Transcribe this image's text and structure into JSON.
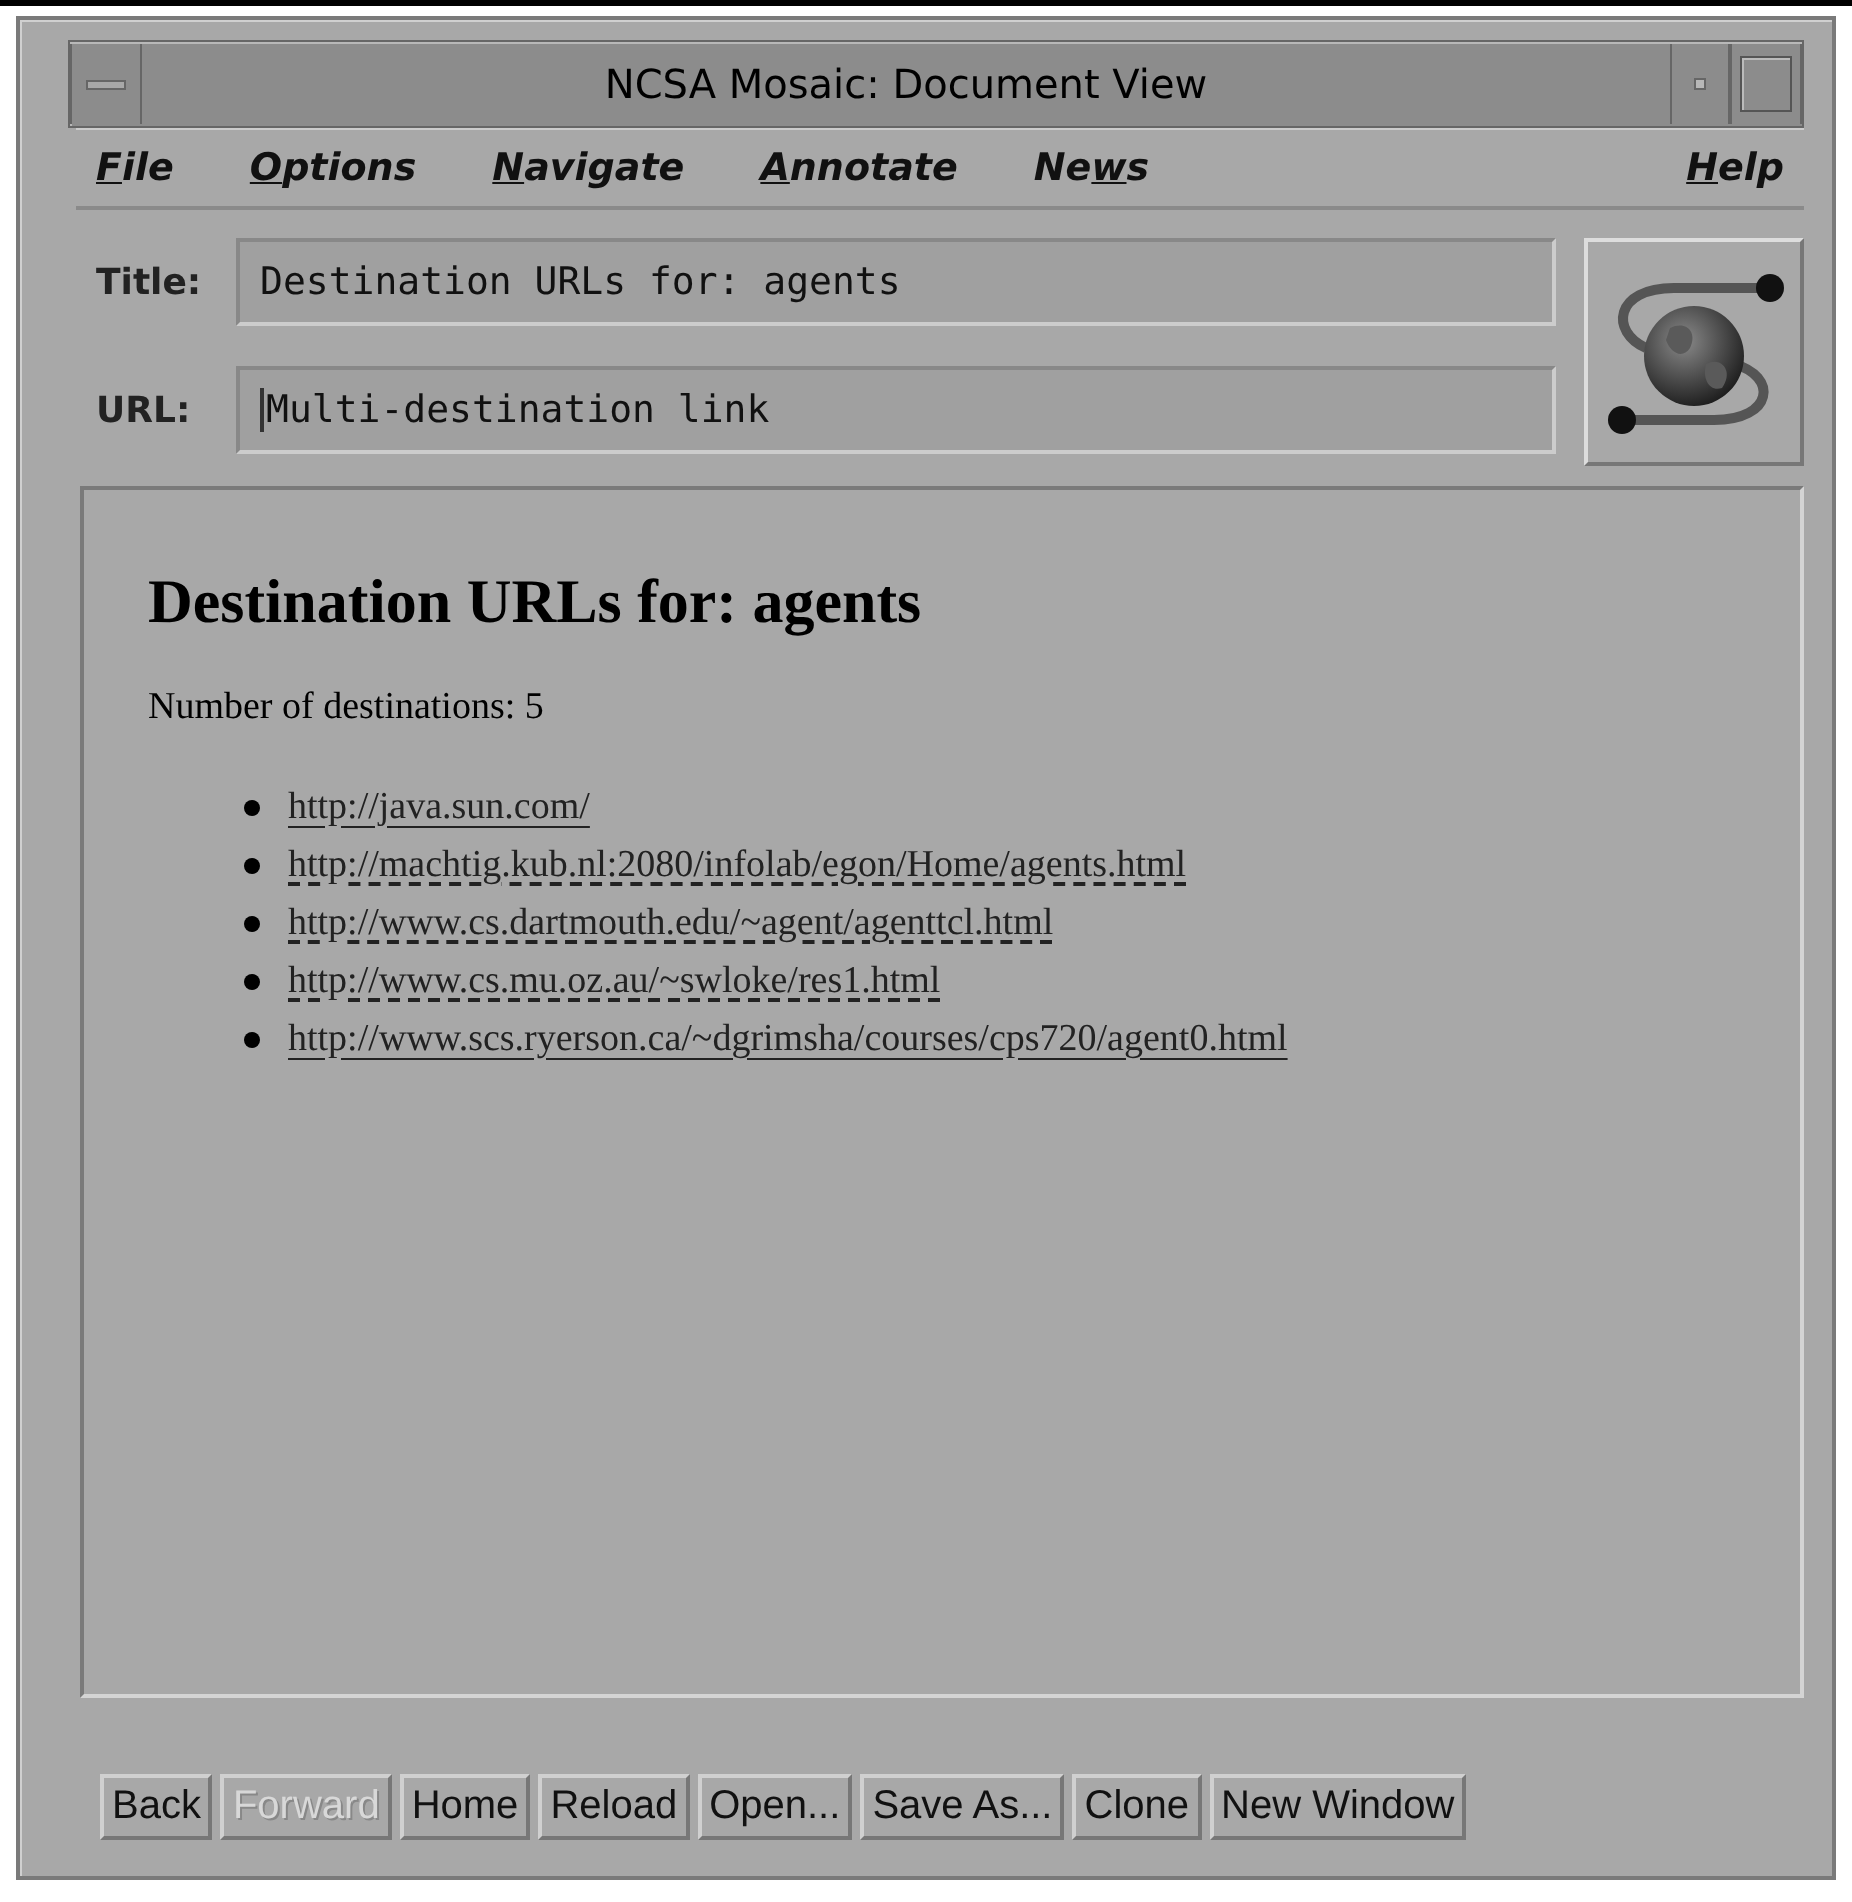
{
  "window": {
    "title": "NCSA Mosaic: Document View"
  },
  "menu": [
    {
      "label": "File"
    },
    {
      "label": "Options"
    },
    {
      "label": "Navigate"
    },
    {
      "label": "Annotate"
    },
    {
      "label": "News"
    }
  ],
  "help_menu": {
    "label": "Help"
  },
  "title_field": {
    "label": "Title:",
    "value": "Destination URLs for: agents"
  },
  "url_field": {
    "label": "URL:",
    "value": "Multi-destination link"
  },
  "document": {
    "heading": "Destination URLs for: agents",
    "text": "Number of destinations: 5",
    "links": [
      {
        "url": "http://java.sun.com/",
        "visited": false
      },
      {
        "url": "http://machtig.kub.nl:2080/infolab/egon/Home/agents.html",
        "visited": true
      },
      {
        "url": "http://www.cs.dartmouth.edu/~agent/agenttcl.html",
        "visited": true
      },
      {
        "url": "http://www.cs.mu.oz.au/~swloke/res1.html",
        "visited": true
      },
      {
        "url": "http://www.scs.ryerson.ca/~dgrimsha/courses/cps720/agent0.html",
        "visited": false
      }
    ]
  },
  "buttons": [
    {
      "label": "Back",
      "disabled": false
    },
    {
      "label": "Forward",
      "disabled": true
    },
    {
      "label": "Home",
      "disabled": false
    },
    {
      "label": "Reload",
      "disabled": false
    },
    {
      "label": "Open...",
      "disabled": false
    },
    {
      "label": "Save As...",
      "disabled": false
    },
    {
      "label": "Clone",
      "disabled": false
    },
    {
      "label": "New Window",
      "disabled": false
    }
  ]
}
